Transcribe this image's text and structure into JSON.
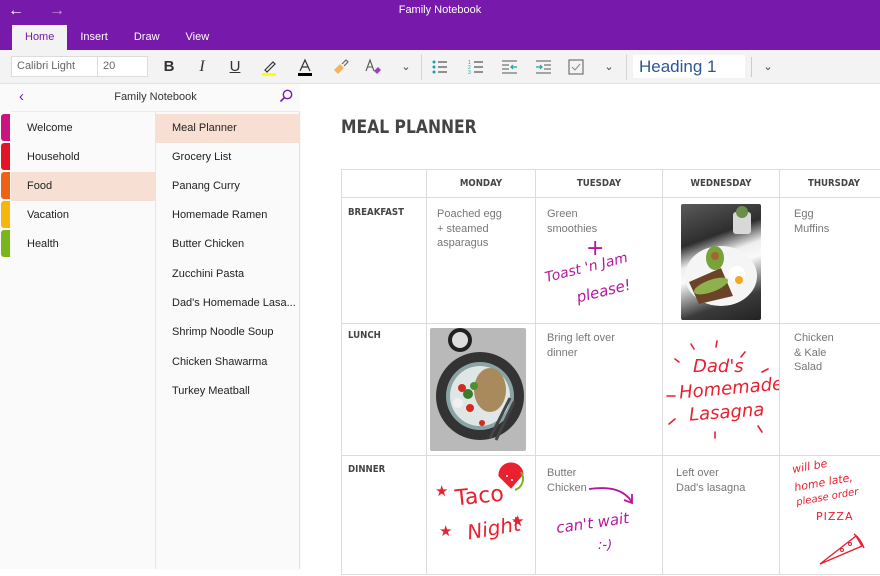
{
  "window": {
    "title": "Family Notebook",
    "back_icon": "arrow-left",
    "forward_icon": "arrow-right"
  },
  "ribbon": {
    "tabs": [
      {
        "label": "Home",
        "active": true
      },
      {
        "label": "Insert",
        "active": false
      },
      {
        "label": "Draw",
        "active": false
      },
      {
        "label": "View",
        "active": false
      }
    ],
    "font_name": "Calibri Light",
    "font_size": "20",
    "bold_label": "B",
    "italic_label": "I",
    "underline_label": "U",
    "style_value": "Heading 1",
    "colors": {
      "brand": "#7719aa",
      "highlight": "#ffff00",
      "font_color": "#000000",
      "list_accent": "#1ba1a1"
    }
  },
  "navigation": {
    "notebook_title": "Family Notebook",
    "sections": [
      {
        "label": "Welcome",
        "color": "#c8157f",
        "active": false
      },
      {
        "label": "Household",
        "color": "#e3132a",
        "active": false
      },
      {
        "label": "Food",
        "color": "#ec6316",
        "active": true
      },
      {
        "label": "Vacation",
        "color": "#f6b60e",
        "active": false
      },
      {
        "label": "Health",
        "color": "#7ab51d",
        "active": false
      }
    ],
    "pages": [
      {
        "label": "Meal Planner",
        "active": true
      },
      {
        "label": "Grocery List",
        "active": false
      },
      {
        "label": "Panang Curry",
        "active": false
      },
      {
        "label": "Homemade Ramen",
        "active": false
      },
      {
        "label": "Butter Chicken",
        "active": false
      },
      {
        "label": "Zucchini Pasta",
        "active": false
      },
      {
        "label": "Dad's Homemade Lasa...",
        "active": false
      },
      {
        "label": "Shrimp Noodle Soup",
        "active": false
      },
      {
        "label": "Chicken Shawarma",
        "active": false
      },
      {
        "label": "Turkey Meatball",
        "active": false
      }
    ]
  },
  "page": {
    "title": "MEAL PLANNER",
    "table": {
      "columns": [
        "MONDAY",
        "TUESDAY",
        "WEDNESDAY",
        "THURSDAY"
      ],
      "rows": [
        {
          "label": "BREAKFAST",
          "monday": {
            "text": [
              "Poached egg",
              "+ steamed",
              "asparagus"
            ]
          },
          "tuesday": {
            "text": [
              "Green",
              "smoothies"
            ],
            "ink": [
              "+",
              "Toast 'n Jam",
              "please!"
            ]
          },
          "wednesday": {
            "image": "avocado toast with poached egg"
          },
          "thursday": {
            "text": [
              "Egg",
              "Muffins"
            ]
          }
        },
        {
          "label": "LUNCH",
          "monday": {
            "image": "grain bowl with salad"
          },
          "tuesday": {
            "text": [
              "Bring left over",
              "dinner"
            ]
          },
          "wednesday": {
            "ink": [
              "Dad's",
              "Homemade",
              "Lasagna"
            ]
          },
          "thursday": {
            "text": [
              "Chicken",
              "& Kale",
              "Salad"
            ]
          }
        },
        {
          "label": "DINNER",
          "monday": {
            "ink": [
              "Taco",
              "Night"
            ]
          },
          "tuesday": {
            "text": [
              "Butter",
              "Chicken"
            ],
            "ink": [
              "can't wait",
              ":-)"
            ]
          },
          "wednesday": {
            "text": [
              "Left over",
              "Dad's lasagna"
            ]
          },
          "thursday": {
            "ink": [
              "will be",
              "home late,",
              "please order",
              "PIZZA"
            ]
          }
        }
      ]
    },
    "ink_colors": {
      "magenta": "#b5179e",
      "red": "#e8202f"
    }
  }
}
